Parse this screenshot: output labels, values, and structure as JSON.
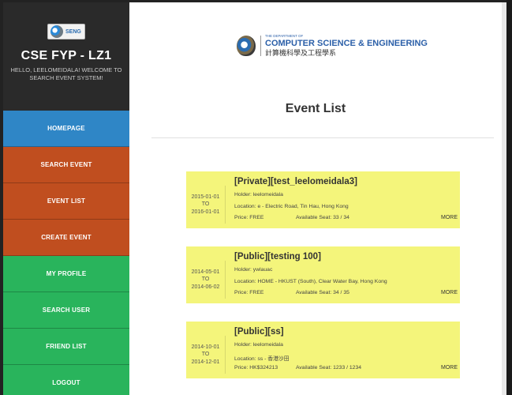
{
  "sidebar": {
    "logo_text": "SENG",
    "title": "CSE FYP - LZ1",
    "subtitle": "HELLO, LEELOMEIDALA! WELCOME TO SEARCH EVENT SYSTEM!",
    "nav": [
      {
        "label": "HOMEPAGE",
        "color": "#2f86c6"
      },
      {
        "label": "SEARCH EVENT",
        "color": "#c04e1f"
      },
      {
        "label": "EVENT LIST",
        "color": "#c04e1f"
      },
      {
        "label": "CREATE EVENT",
        "color": "#c04e1f"
      },
      {
        "label": "MY PROFILE",
        "color": "#29b45c"
      },
      {
        "label": "SEARCH USER",
        "color": "#29b45c"
      },
      {
        "label": "FRIEND LIST",
        "color": "#29b45c"
      },
      {
        "label": "LOGOUT",
        "color": "#29b45c"
      }
    ]
  },
  "header": {
    "dept_small": "THE DEPARTMENT OF",
    "dept_name": "COMPUTER SCIENCE & ENGINEERING",
    "dept_cn": "計算機科學及工程學系"
  },
  "page": {
    "title": "Event List"
  },
  "events": [
    {
      "start": "2015-01-01",
      "to": "TO",
      "end": "2016-01-01",
      "title": "[Private][test_leelomeidala3]",
      "holder": "Holder: leelomeidala",
      "location": "Location: e - Electric Road, Tin Hau, Hong Kong",
      "price": "Price: FREE",
      "seat": "Available Seat: 33 / 34",
      "more": "MORE"
    },
    {
      "start": "2014-05-01",
      "to": "TO",
      "end": "2014-06-02",
      "title": "[Public][testing 100]",
      "holder": "Holder: ywlauac",
      "location": "Location: HOME - HKUST (South), Clear Water Bay, Hong Kong",
      "price": "Price: FREE",
      "seat": "Available Seat: 34 / 35",
      "more": "MORE"
    },
    {
      "start": "2014-10-01",
      "to": "TO",
      "end": "2014-12-01",
      "title": "[Public][ss]",
      "holder": "Holder: leelomeidala",
      "location": "Location: ss - 香港沙田",
      "price": "Price: HK$324213",
      "seat": "Available Seat: 1233 / 1234",
      "more": "MORE"
    }
  ],
  "colors": {
    "sidebar_bg": "#2a2a2a",
    "nav_blue": "#2f86c6",
    "nav_orange": "#c04e1f",
    "nav_green": "#29b45c",
    "event_card": "#f4f57b"
  }
}
